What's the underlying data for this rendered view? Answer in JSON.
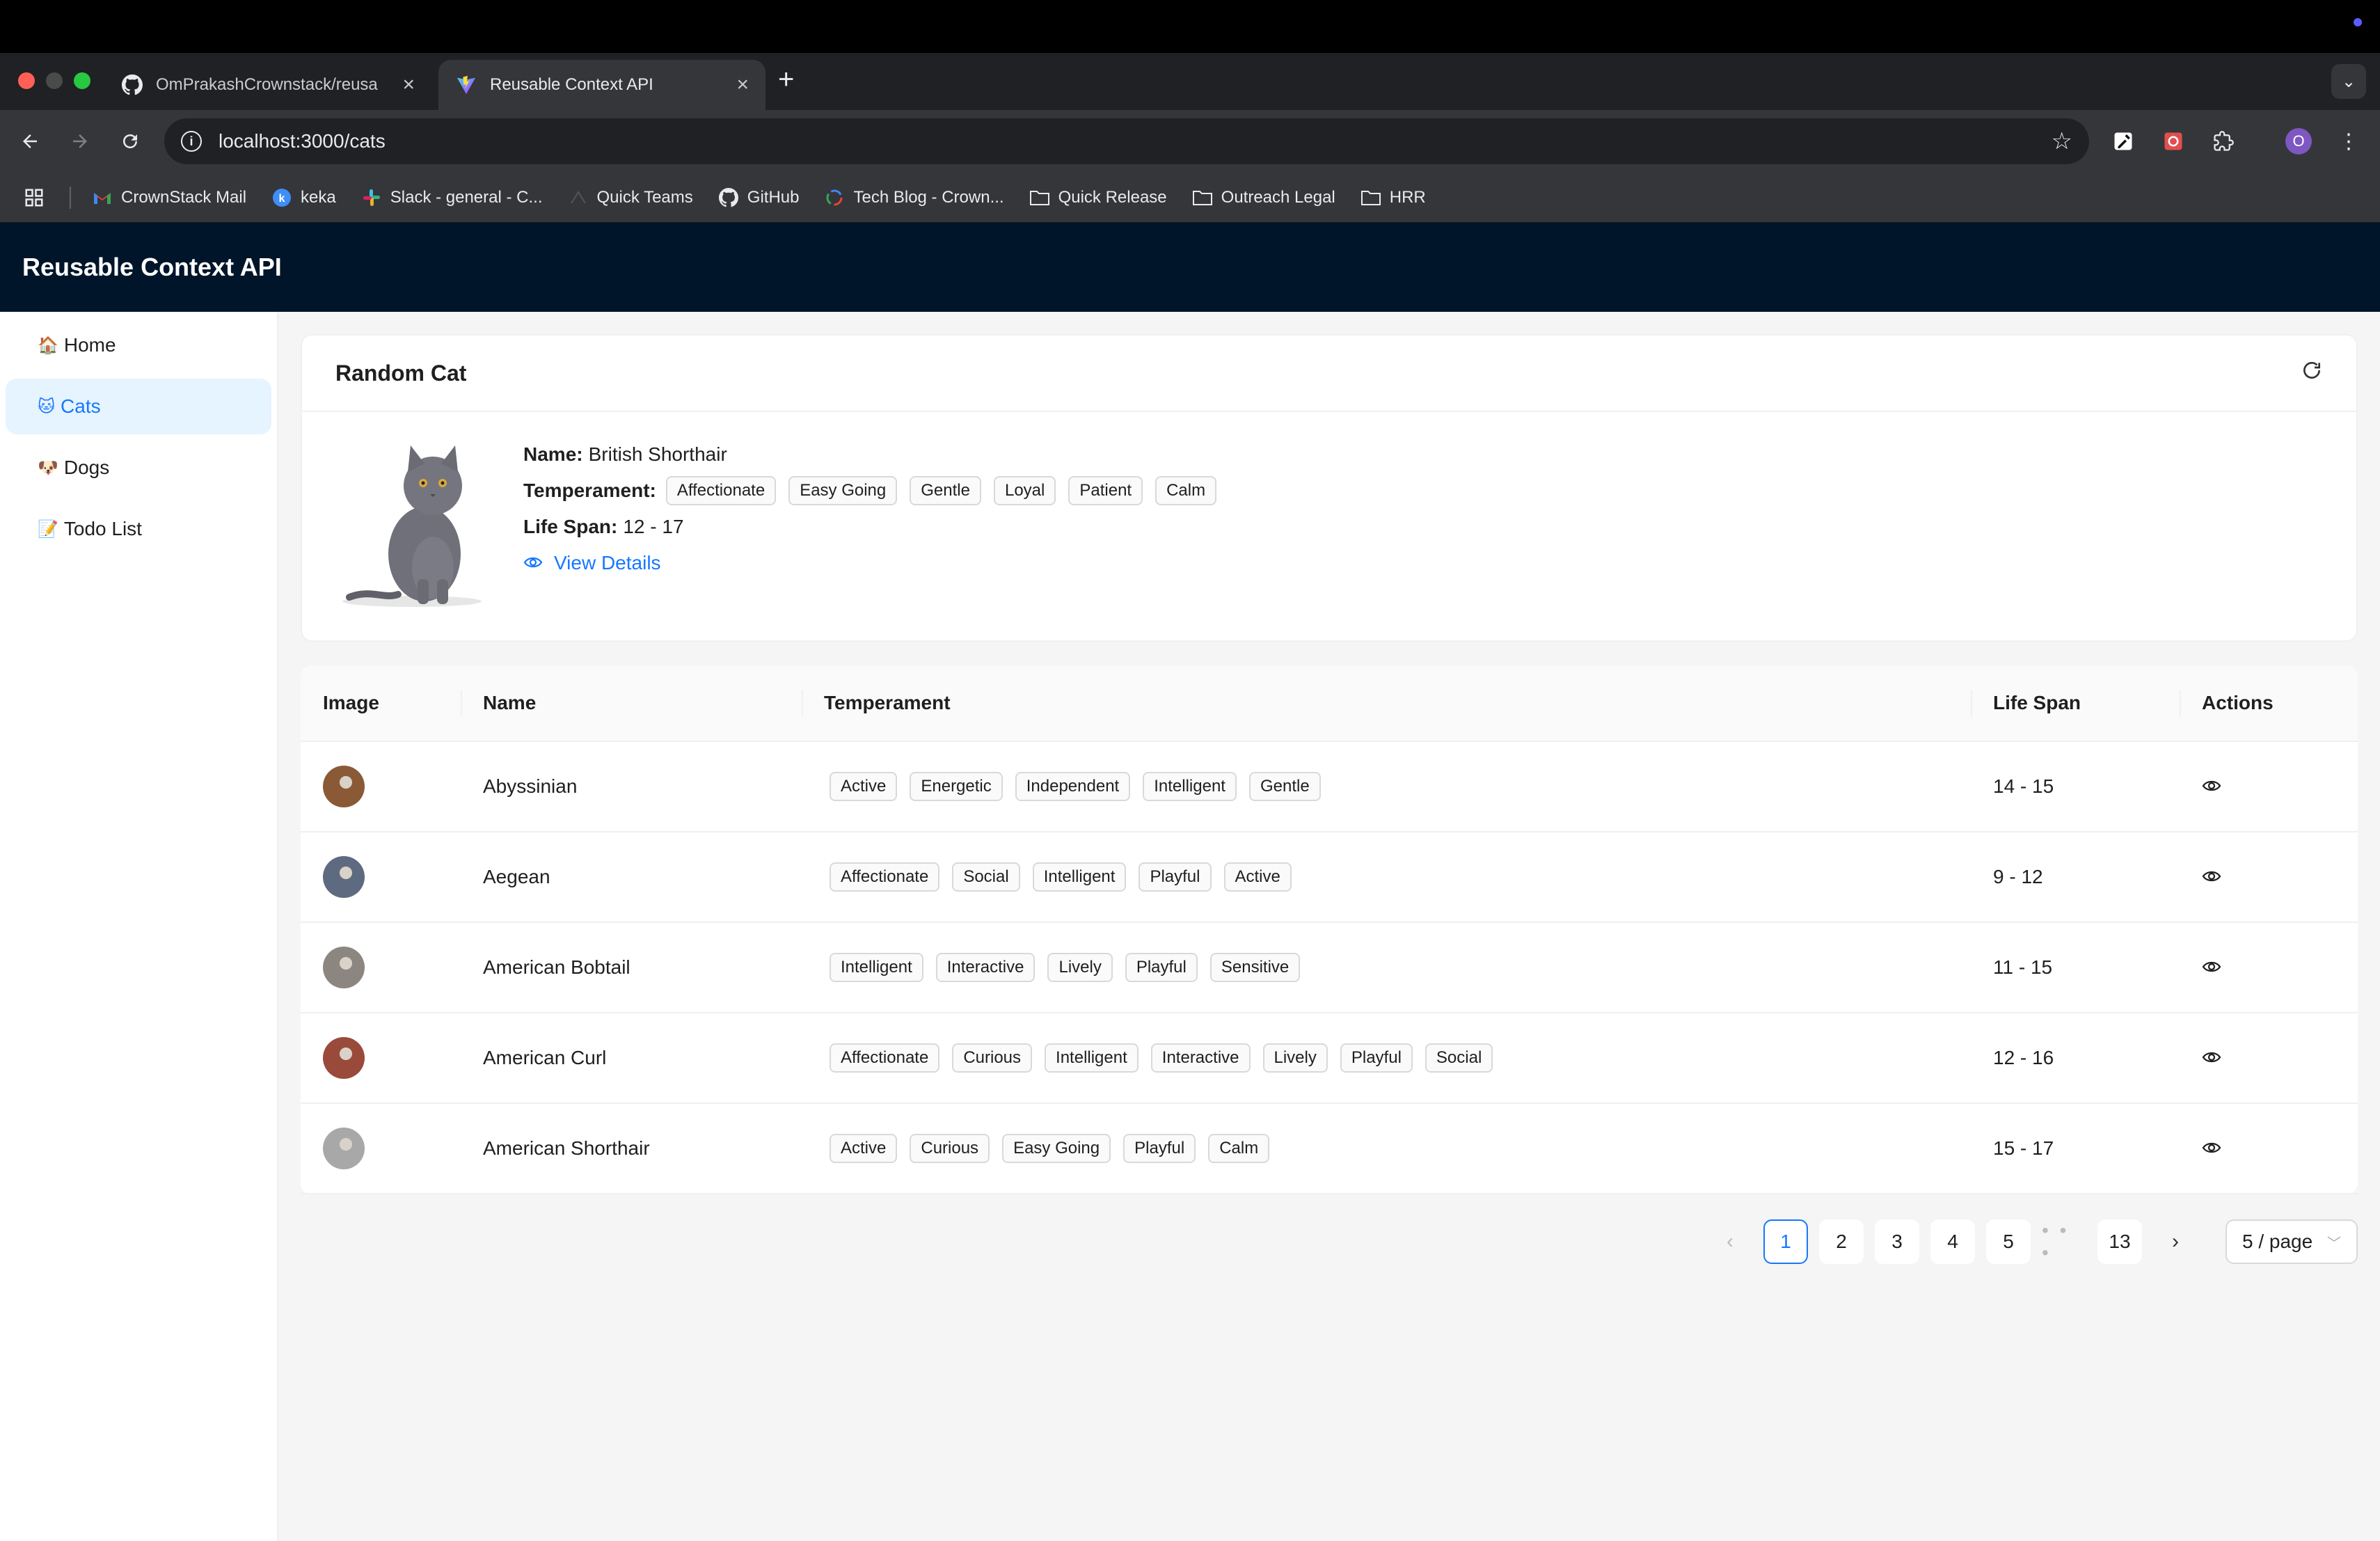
{
  "browser": {
    "tabs": [
      {
        "title": "OmPrakashCrownstack/reusa",
        "favicon": "github-icon"
      },
      {
        "title": "Reusable Context API",
        "favicon": "vite-icon"
      }
    ],
    "url": "localhost:3000/cats",
    "profile_initial": "O",
    "bookmarks": [
      {
        "label": "CrownStack Mail",
        "icon": "gmail-icon"
      },
      {
        "label": "keka",
        "icon": "keka-icon"
      },
      {
        "label": "Slack - general - C...",
        "icon": "slack-icon"
      },
      {
        "label": "Quick Teams",
        "icon": "teams-icon"
      },
      {
        "label": "GitHub",
        "icon": "github-icon"
      },
      {
        "label": "Tech Blog - Crown...",
        "icon": "blog-icon"
      },
      {
        "label": "Quick Release",
        "icon": "folder-icon"
      },
      {
        "label": "Outreach Legal",
        "icon": "folder-icon"
      },
      {
        "label": "HRR",
        "icon": "folder-icon"
      }
    ]
  },
  "app": {
    "title": "Reusable Context API"
  },
  "sidebar": {
    "items": [
      {
        "emoji": "🏠",
        "label": "Home",
        "selected": false
      },
      {
        "emoji": "🐱",
        "label": "Cats",
        "selected": true
      },
      {
        "emoji": "🐶",
        "label": "Dogs",
        "selected": false
      },
      {
        "emoji": "📝",
        "label": "Todo List",
        "selected": false
      }
    ]
  },
  "random_cat": {
    "title": "Random Cat",
    "name_label": "Name:",
    "name": "British Shorthair",
    "temperament_label": "Temperament:",
    "temperament": [
      "Affectionate",
      "Easy Going",
      "Gentle",
      "Loyal",
      "Patient",
      "Calm"
    ],
    "life_span_label": "Life Span:",
    "life_span": "12 - 17",
    "view_details": "View Details"
  },
  "table": {
    "headers": {
      "image": "Image",
      "name": "Name",
      "temperament": "Temperament",
      "life_span": "Life Span",
      "actions": "Actions"
    },
    "rows": [
      {
        "name": "Abyssinian",
        "temperament": [
          "Active",
          "Energetic",
          "Independent",
          "Intelligent",
          "Gentle"
        ],
        "life_span": "14 - 15",
        "thumb_color": "#8a5a36"
      },
      {
        "name": "Aegean",
        "temperament": [
          "Affectionate",
          "Social",
          "Intelligent",
          "Playful",
          "Active"
        ],
        "life_span": "9 - 12",
        "thumb_color": "#5e6a80"
      },
      {
        "name": "American Bobtail",
        "temperament": [
          "Intelligent",
          "Interactive",
          "Lively",
          "Playful",
          "Sensitive"
        ],
        "life_span": "11 - 15",
        "thumb_color": "#8b8680"
      },
      {
        "name": "American Curl",
        "temperament": [
          "Affectionate",
          "Curious",
          "Intelligent",
          "Interactive",
          "Lively",
          "Playful",
          "Social"
        ],
        "life_span": "12 - 16",
        "thumb_color": "#9a4a3a"
      },
      {
        "name": "American Shorthair",
        "temperament": [
          "Active",
          "Curious",
          "Easy Going",
          "Playful",
          "Calm"
        ],
        "life_span": "15 - 17",
        "thumb_color": "#a8a8a8"
      }
    ]
  },
  "pagination": {
    "pages": [
      "1",
      "2",
      "3",
      "4",
      "5"
    ],
    "ellipsis": "• • •",
    "last": "13",
    "current": "1",
    "page_size": "5 / page"
  }
}
